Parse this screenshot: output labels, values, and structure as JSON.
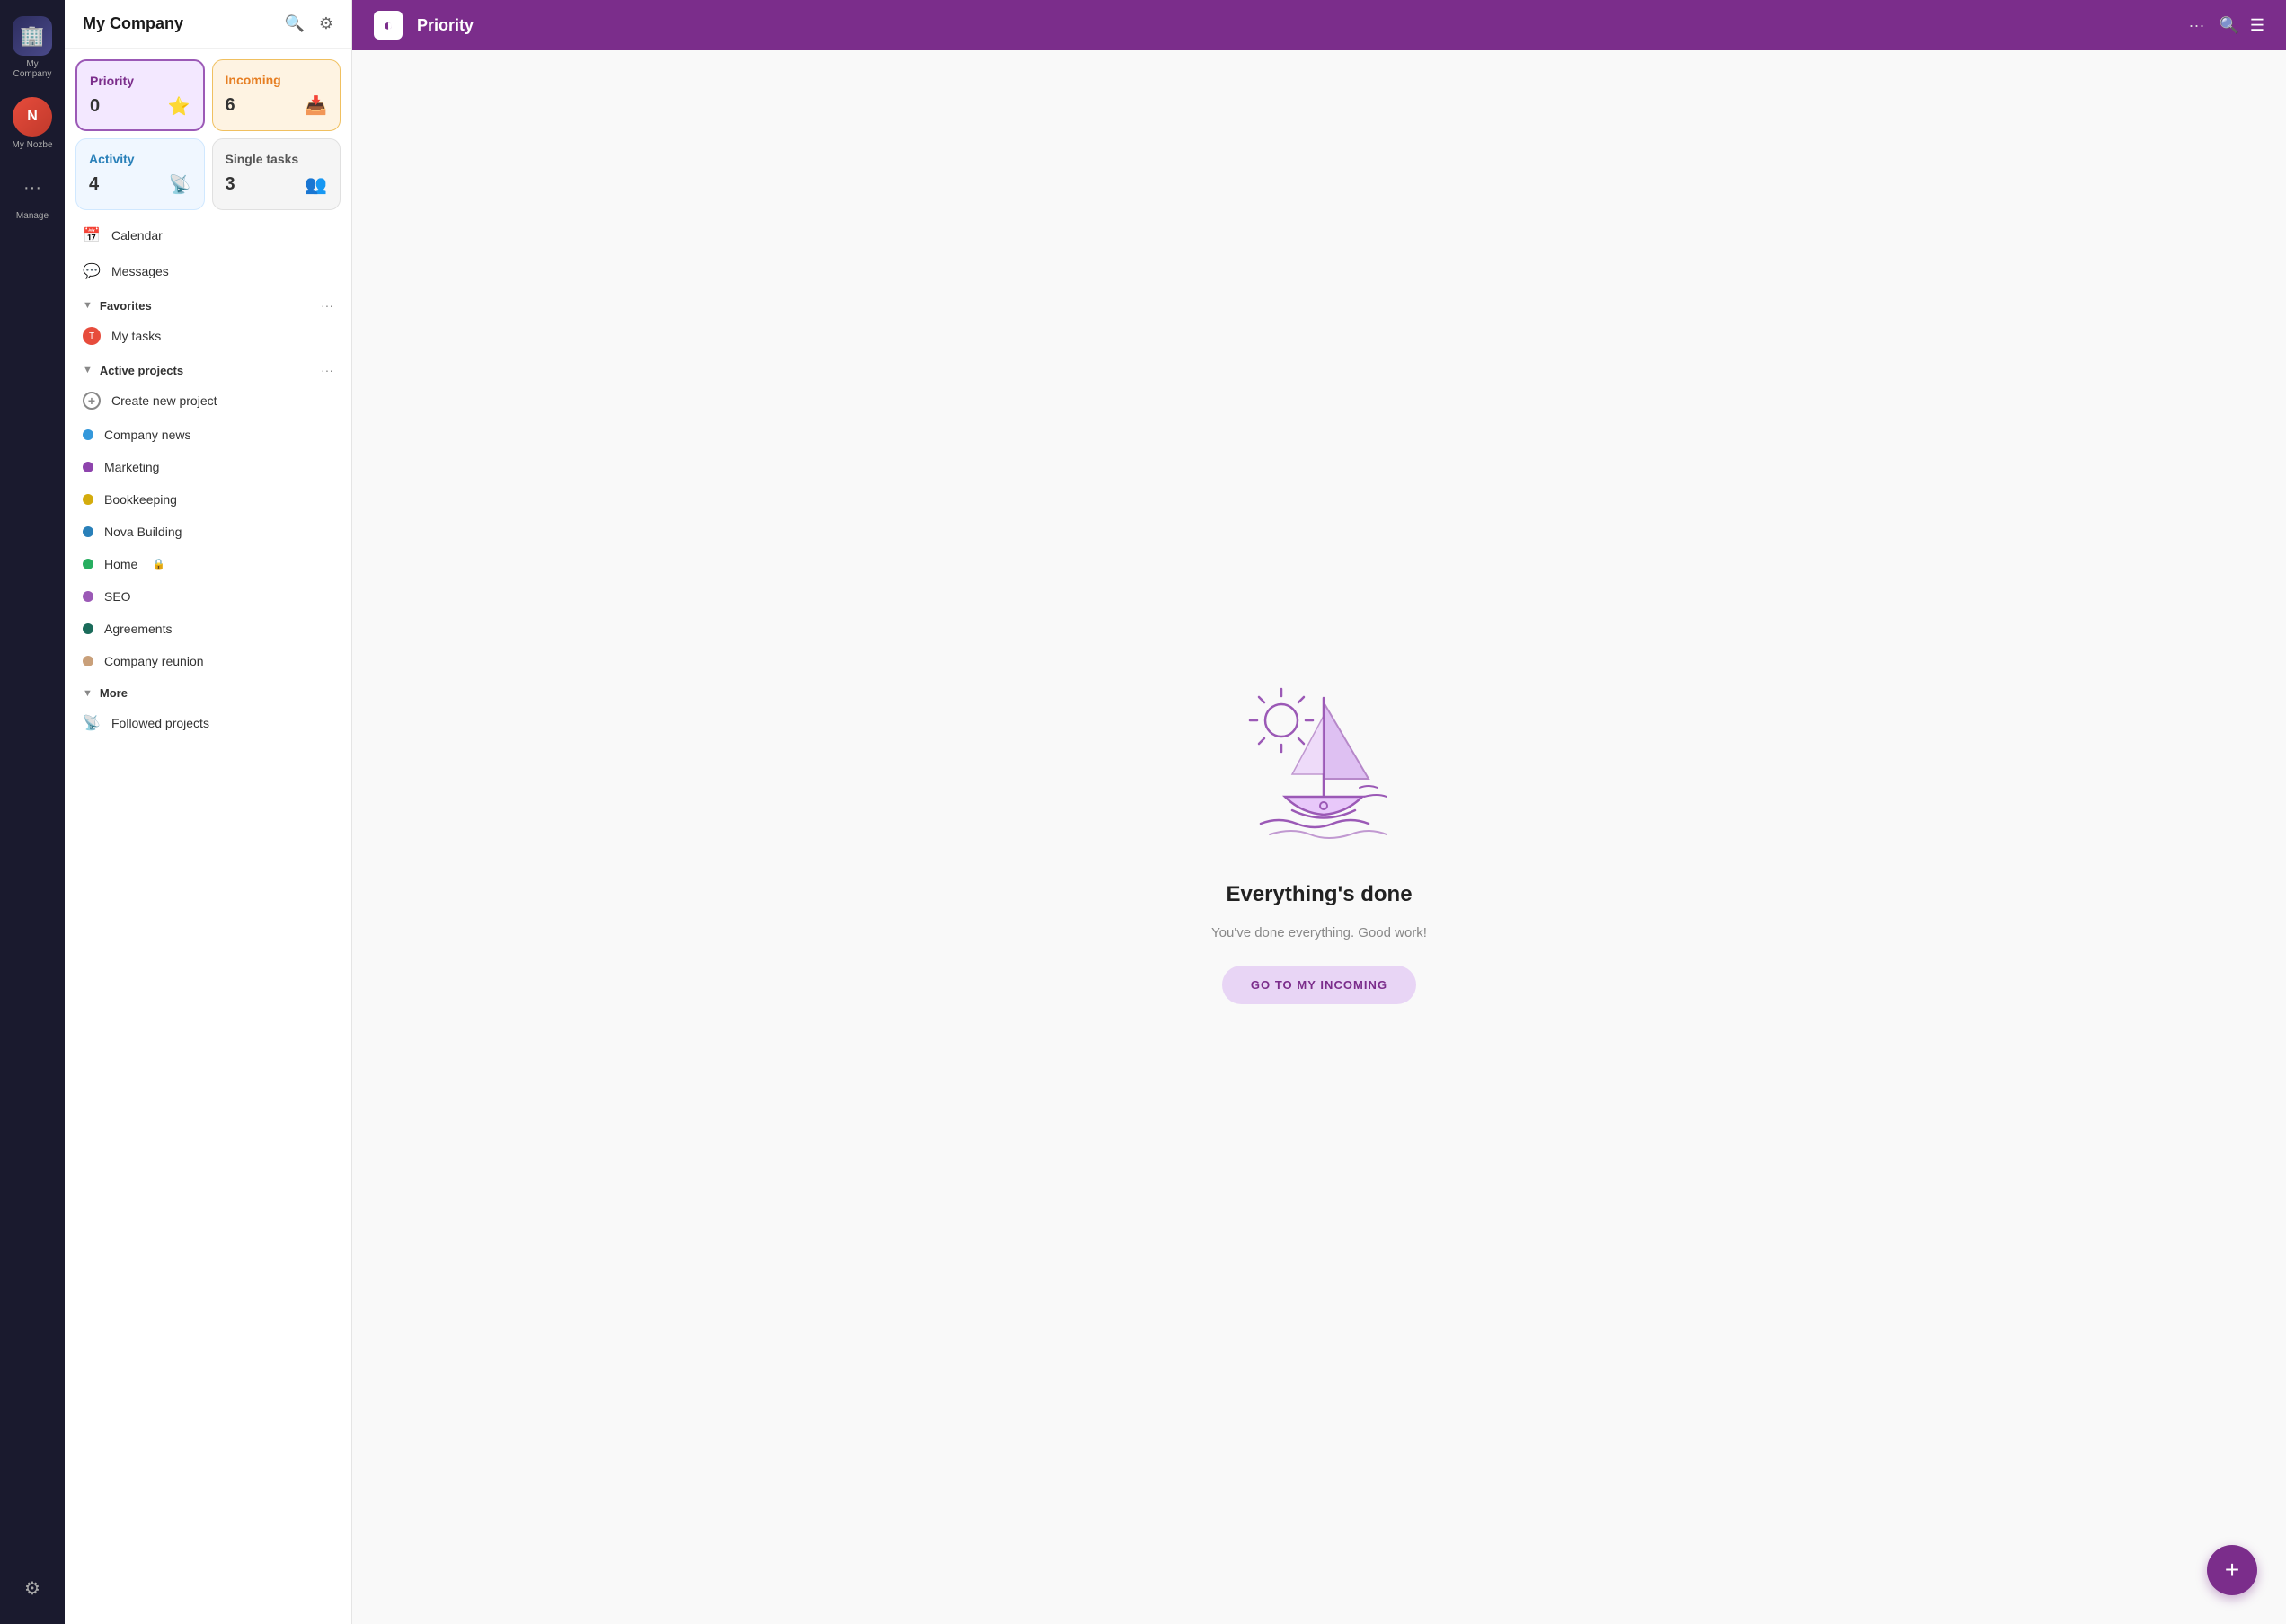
{
  "app": {
    "company_name": "My Company",
    "icon_label_company": "My Company",
    "icon_label_nozbe": "My Nozbe",
    "icon_label_manage": "Manage"
  },
  "sidebar": {
    "search_icon": "🔍",
    "settings_icon": "⚙",
    "cards": [
      {
        "id": "priority",
        "label": "Priority",
        "count": "0",
        "type": "priority"
      },
      {
        "id": "incoming",
        "label": "Incoming",
        "count": "6",
        "type": "incoming"
      },
      {
        "id": "activity",
        "label": "Activity",
        "count": "4",
        "type": "activity"
      },
      {
        "id": "single",
        "label": "Single tasks",
        "count": "3",
        "type": "single"
      }
    ],
    "nav_items": [
      {
        "id": "calendar",
        "label": "Calendar",
        "icon": "📅"
      },
      {
        "id": "messages",
        "label": "Messages",
        "icon": "💬"
      }
    ],
    "favorites": {
      "title": "Favorites",
      "items": [
        {
          "id": "my-tasks",
          "label": "My tasks",
          "has_avatar": true
        }
      ]
    },
    "active_projects": {
      "title": "Active projects",
      "items": [
        {
          "id": "create-new",
          "label": "Create new project",
          "color": null,
          "is_create": true
        },
        {
          "id": "company-news",
          "label": "Company news",
          "color": "#3498db"
        },
        {
          "id": "marketing",
          "label": "Marketing",
          "color": "#8e44ad"
        },
        {
          "id": "bookkeeping",
          "label": "Bookkeeping",
          "color": "#d4ac0d"
        },
        {
          "id": "nova-building",
          "label": "Nova Building",
          "color": "#2980b9"
        },
        {
          "id": "home",
          "label": "Home",
          "color": "#27ae60",
          "locked": true
        },
        {
          "id": "seo",
          "label": "SEO",
          "color": "#9b59b6"
        },
        {
          "id": "agreements",
          "label": "Agreements",
          "color": "#1a6b5a"
        },
        {
          "id": "company-reunion",
          "label": "Company reunion",
          "color": "#c9a07a"
        }
      ]
    },
    "more": {
      "title": "More",
      "items": [
        {
          "id": "followed-projects",
          "label": "Followed projects",
          "icon": "📡"
        }
      ]
    }
  },
  "main": {
    "header": {
      "title": "Priority",
      "logo_letter": "◐",
      "dots_label": "···"
    },
    "empty_state": {
      "title": "Everything's done",
      "subtitle": "You've done everything. Good work!",
      "button_label": "GO TO MY INCOMING"
    }
  },
  "fab": {
    "icon": "+"
  }
}
